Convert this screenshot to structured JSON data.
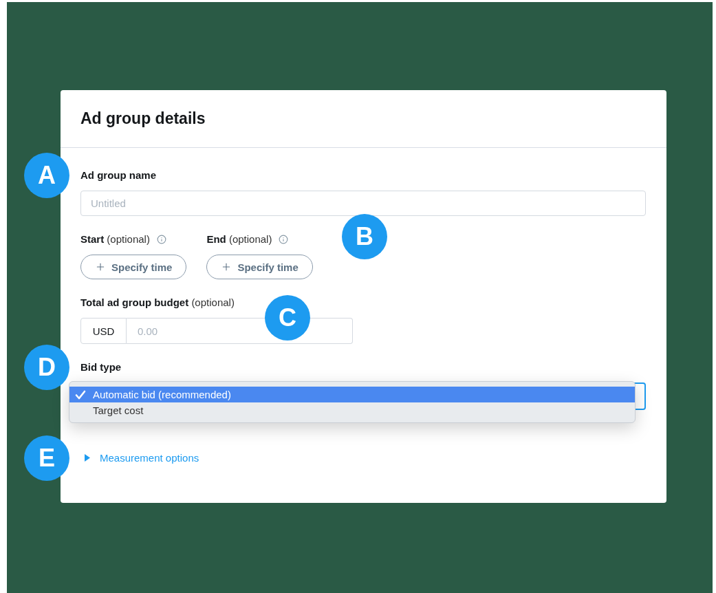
{
  "card": {
    "title": "Ad group details"
  },
  "fields": [
    {
      "kind": "text",
      "marker": "A",
      "label": "Ad group name",
      "placeholder": "Untitled"
    },
    {
      "kind": "times",
      "marker": "B",
      "items": [
        {
          "label": "Start",
          "note": "(optional)",
          "button": "Specify time"
        },
        {
          "label": "End",
          "note": "(optional)",
          "button": "Specify time"
        }
      ]
    },
    {
      "kind": "currency",
      "marker": "C",
      "label": "Total ad group budget",
      "note": "(optional)",
      "currency": "USD",
      "placeholder": "0.00"
    },
    {
      "kind": "select",
      "marker": "D",
      "label": "Bid type",
      "expanded": true,
      "options": [
        {
          "label": "Automatic bid (recommended)",
          "selected": true
        },
        {
          "label": "Target cost",
          "selected": false
        }
      ]
    },
    {
      "kind": "disclosure",
      "marker": "E",
      "label": "Measurement options",
      "expanded": false
    }
  ]
}
